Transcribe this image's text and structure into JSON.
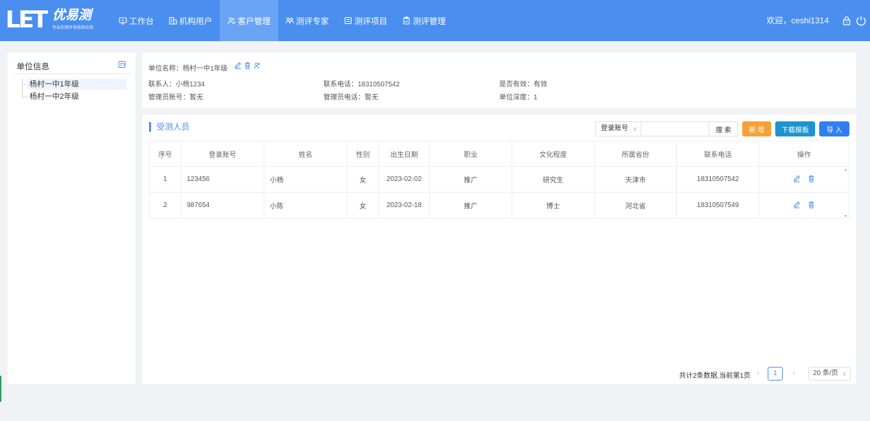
{
  "brand": {
    "letters": "LET",
    "name": "优易测",
    "slogan": "专业的测评系统供应商"
  },
  "nav": [
    {
      "label": "工作台",
      "icon": "monitor-icon"
    },
    {
      "label": "机构用户",
      "icon": "building-icon"
    },
    {
      "label": "客户管理",
      "icon": "users-icon"
    },
    {
      "label": "测评专家",
      "icon": "experts-icon"
    },
    {
      "label": "测评项目",
      "icon": "list-icon"
    },
    {
      "label": "测评管理",
      "icon": "clipboard-icon"
    }
  ],
  "nav_active_index": 2,
  "header": {
    "welcome": "欢迎，ceshi1314"
  },
  "sidebar": {
    "title": "单位信息",
    "items": [
      {
        "label": "杨村一中1年级"
      },
      {
        "label": "杨村一中2年级"
      }
    ],
    "selected_index": 0
  },
  "info": {
    "unit_name": "单位名称：杨村一中1年级",
    "contact": "联系人：小杨1234",
    "phone": "联系电话：18310507542",
    "valid": "是否有效：有效",
    "admin_account": "管理员账号：暂无",
    "admin_phone": "管理员电话：暂无",
    "depth": "单位深度：1"
  },
  "section": {
    "title": "受测人员"
  },
  "search": {
    "field": "登录账号",
    "value": "",
    "button": "搜 索"
  },
  "buttons": {
    "add": "新 增",
    "download": "下载模板",
    "import": "导 入"
  },
  "table": {
    "headers": [
      "序号",
      "登录账号",
      "姓名",
      "性别",
      "出生日期",
      "职业",
      "文化程度",
      "所属省份",
      "联系电话",
      "操作"
    ],
    "rows": [
      [
        "1",
        "123456",
        "小杨",
        "女",
        "2023-02-02",
        "推广",
        "研究生",
        "天津市",
        "18310507542"
      ],
      [
        "2",
        "987654",
        "小陈",
        "女",
        "2023-02-18",
        "推广",
        "博士",
        "河北省",
        "18310507549"
      ]
    ]
  },
  "pagination": {
    "summary": "共计2条数据,当前第1页",
    "prev": "‹",
    "current": "1",
    "next": "›",
    "page_size": "20 条/页"
  },
  "colors": {
    "header_bg": "#4a8ef0",
    "active_nav": "#6aa5f5",
    "add_btn": "#f7a035",
    "download_btn": "#1d93d0",
    "import_btn": "#2f7ff0"
  }
}
